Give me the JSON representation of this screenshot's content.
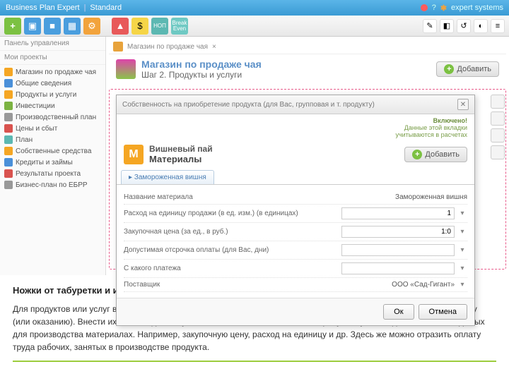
{
  "titlebar": {
    "app": "Business Plan Expert",
    "edition": "Standard",
    "brand": "expert systems"
  },
  "sidebar": {
    "header": "Панель управления",
    "section1": "Мои проекты",
    "items": [
      "Магазин по продаже чая",
      "Общие сведения",
      "Продукты и услуги",
      "Инвестиции",
      "Производственный план",
      "Цены и сбыт",
      "План",
      "Собственные средства",
      "Кредиты и займы",
      "Результаты проекта",
      "Бизнес-план по ЕБРР"
    ]
  },
  "breadcrumb": {
    "item": "Магазин по продаже чая"
  },
  "page": {
    "title": "Магазин по продаже чая",
    "step": "Шаг 2. Продукты и услуги",
    "add_label": "Добавить"
  },
  "dialog": {
    "title": "Собственность на приобретение продукта (для Вас, групповая и т. продукту)",
    "status_title": "Включено!",
    "status_line1": "Данные этой вкладки",
    "status_line2": "учитываются в расчетах",
    "product": "Вишневый пай",
    "materials": "Материалы",
    "add_label": "Добавить",
    "tab": "Замороженная вишня",
    "rows": {
      "r1": {
        "label": "Название материала",
        "value": "Замороженная вишня"
      },
      "r2": {
        "label": "Расход на единицу продажи (в ед. изм.) (в единицах)",
        "value": "1"
      },
      "r3": {
        "label": "Закупочная цена (за ед., в руб.)",
        "value": "1:0"
      },
      "r4": {
        "label": "Допустимая отсрочка оплаты (для Вас, дни)",
        "value": ""
      },
      "r5": {
        "label": "С какого платежа",
        "value": ""
      },
      "r6": {
        "label": "Поставщик",
        "value": "ООО «Сад-Гигант»"
      }
    },
    "ok": "Ок",
    "cancel": "Отмена"
  },
  "bottom": {
    "title": "Ножки от табуретки и ингредиенты пиццы – материалы, из которых создан конечный продукт!",
    "body": "Для продуктов или услуг вам потребуется указать прямые затраты, непосредственно относящиеся к их производству (или оказанию). Внести их можно единой суммой или по схеме. Также вам потребуется указать данные о необходимых для производства материалах. Например, закупочную цену, расход на единицу и др. Здесь же можно отразить оплату труда рабочих, занятых в производстве продукта."
  }
}
